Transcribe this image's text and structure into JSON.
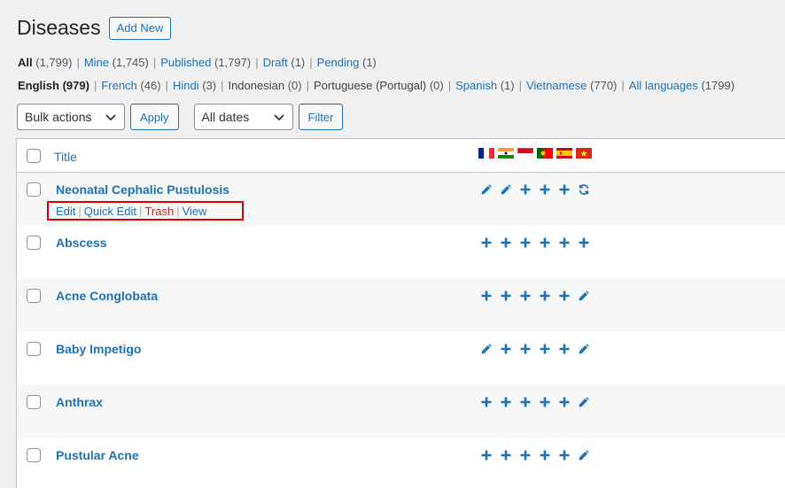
{
  "header": {
    "title": "Diseases",
    "add_new": "Add New"
  },
  "status_links": [
    {
      "label": "All",
      "count": "(1,799)"
    },
    {
      "label": "Mine",
      "count": "(1,745)"
    },
    {
      "label": "Published",
      "count": "(1,797)"
    },
    {
      "label": "Draft",
      "count": "(1)"
    },
    {
      "label": "Pending",
      "count": "(1)"
    }
  ],
  "language_links": [
    {
      "label": "English",
      "count": "(979)"
    },
    {
      "label": "French",
      "count": "(46)"
    },
    {
      "label": "Hindi",
      "count": "(3)"
    },
    {
      "label": "Indonesian",
      "count": "(0)"
    },
    {
      "label": "Portuguese (Portugal)",
      "count": "(0)"
    },
    {
      "label": "Spanish",
      "count": "(1)"
    },
    {
      "label": "Vietnamese",
      "count": "(770)"
    },
    {
      "label": "All languages",
      "count": "(1799)"
    }
  ],
  "tablenav": {
    "bulk_actions": "Bulk actions",
    "apply": "Apply",
    "dates": "All dates",
    "filter": "Filter"
  },
  "table": {
    "title_header": "Title",
    "flags": [
      "france-flag",
      "india-flag",
      "indonesia-flag",
      "portugal-flag",
      "spain-flag",
      "vietnam-flag"
    ],
    "row_actions": {
      "edit": "Edit",
      "quick_edit": "Quick Edit",
      "trash": "Trash",
      "view": "View"
    },
    "rows": [
      {
        "title": "Neonatal Cephalic Pustulosis",
        "icons": [
          "pencil-icon",
          "pencil-icon",
          "plus-icon",
          "plus-icon",
          "plus-icon",
          "sync-icon"
        ]
      },
      {
        "title": "Abscess",
        "icons": [
          "plus-icon",
          "plus-icon",
          "plus-icon",
          "plus-icon",
          "plus-icon",
          "plus-icon"
        ]
      },
      {
        "title": "Acne Conglobata",
        "icons": [
          "plus-icon",
          "plus-icon",
          "plus-icon",
          "plus-icon",
          "plus-icon",
          "pencil-icon"
        ]
      },
      {
        "title": "Baby Impetigo",
        "icons": [
          "pencil-icon",
          "plus-icon",
          "plus-icon",
          "plus-icon",
          "plus-icon",
          "pencil-icon"
        ]
      },
      {
        "title": "Anthrax",
        "icons": [
          "plus-icon",
          "plus-icon",
          "plus-icon",
          "plus-icon",
          "plus-icon",
          "pencil-icon"
        ]
      },
      {
        "title": "Pustular Acne",
        "icons": [
          "plus-icon",
          "plus-icon",
          "plus-icon",
          "plus-icon",
          "plus-icon",
          "pencil-icon"
        ]
      }
    ]
  },
  "colors": {
    "link": "#2271b1",
    "highlight_box": "#d60000",
    "trash": "#b32d2e"
  }
}
